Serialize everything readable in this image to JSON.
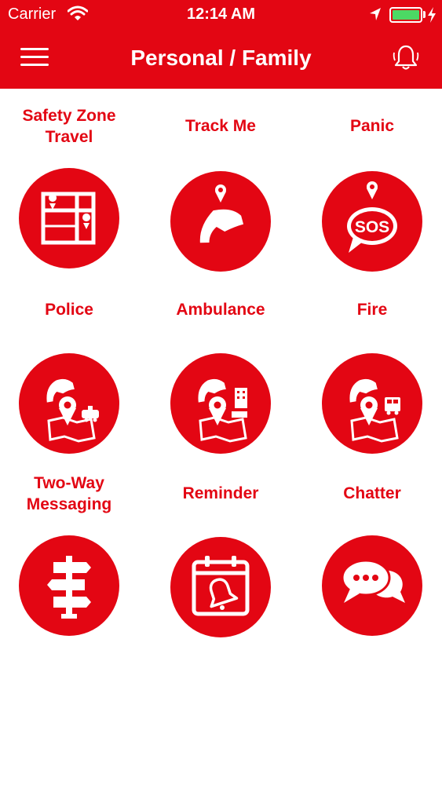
{
  "status_bar": {
    "carrier": "Carrier",
    "time": "12:14 AM"
  },
  "header": {
    "title": "Personal / Family",
    "menu_icon": "hamburger-menu-icon",
    "notification_icon": "bell-icon"
  },
  "colors": {
    "brand": "#e30613",
    "battery": "#4cd964",
    "background": "#ffffff"
  },
  "grid": [
    {
      "label": "Safety Zone\nTravel",
      "icon": "map-zone-icon"
    },
    {
      "label": "Track Me",
      "icon": "phone-location-icon"
    },
    {
      "label": "Panic",
      "icon": "sos-bubble-icon"
    },
    {
      "label": "Police",
      "icon": "police-call-icon"
    },
    {
      "label": "Ambulance",
      "icon": "ambulance-call-icon"
    },
    {
      "label": "Fire",
      "icon": "fire-call-icon"
    },
    {
      "label": "Two-Way\nMessaging",
      "icon": "signpost-icon"
    },
    {
      "label": "Reminder",
      "icon": "calendar-bell-icon"
    },
    {
      "label": "Chatter",
      "icon": "chat-bubbles-icon"
    }
  ]
}
